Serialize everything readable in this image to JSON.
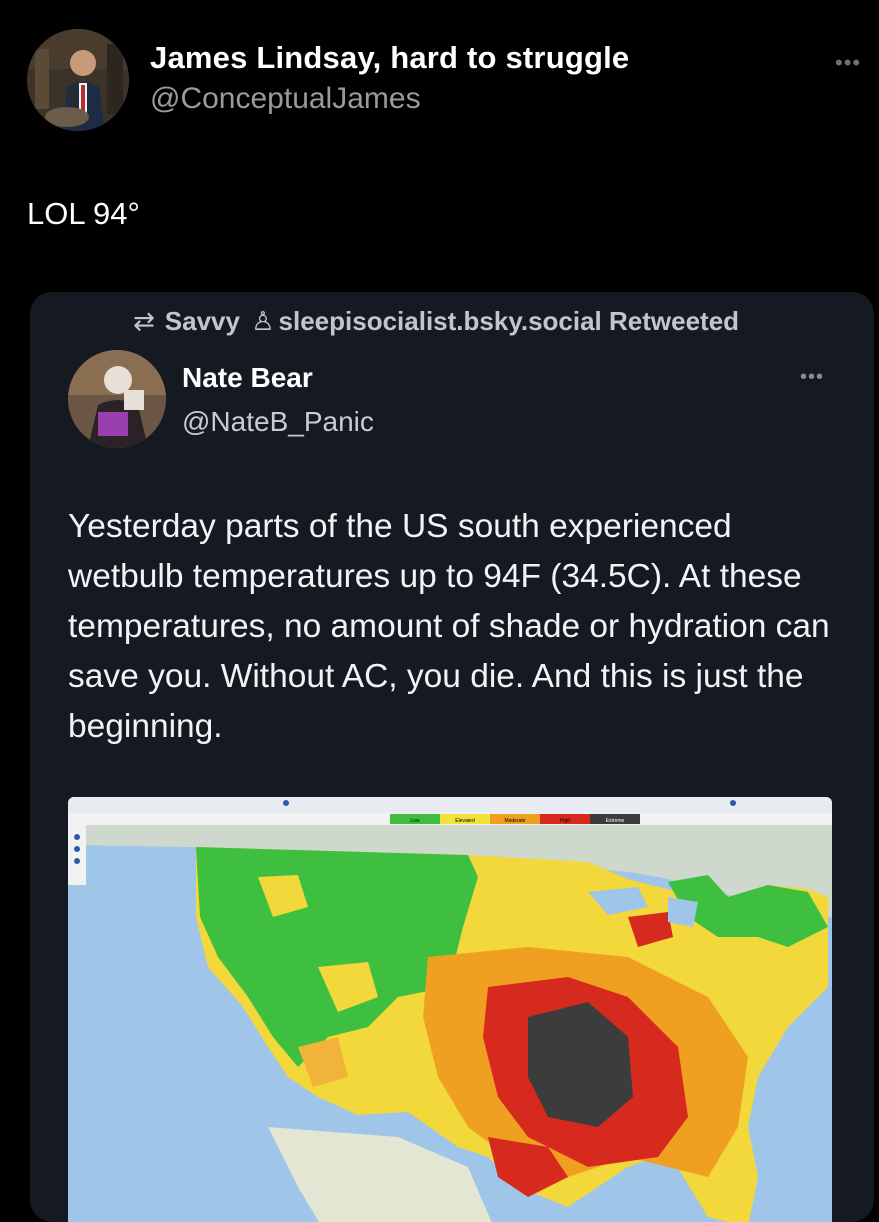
{
  "tweet": {
    "author_name": "James Lindsay, hard to struggle",
    "author_handle": "@ConceptualJames",
    "more_icon": "more-icon",
    "text": "LOL 94°"
  },
  "quoted": {
    "retweet_line": "Savvy ♀ sleepisocialist.bsky.social Retweeted",
    "retweet_prefix": "Savvy",
    "retweet_suffix": "sleepisocialist.bsky.social Retweeted",
    "author_name": "Nate Bear",
    "author_handle": "@NateB_Panic",
    "body": "Yesterday parts of the US south experienced wetbulb temperatures up to 94F (34.5C). At these temperatures, no amount of shade or hydration can save you. Without AC, you die. And this is just the beginning.",
    "map_legend": [
      "Low",
      "Elevated",
      "Moderate",
      "High",
      "Extreme"
    ],
    "map_legend_colors": [
      "#3fbf3f",
      "#f2e23a",
      "#f0a020",
      "#d62a1e",
      "#3c3c3c"
    ]
  }
}
